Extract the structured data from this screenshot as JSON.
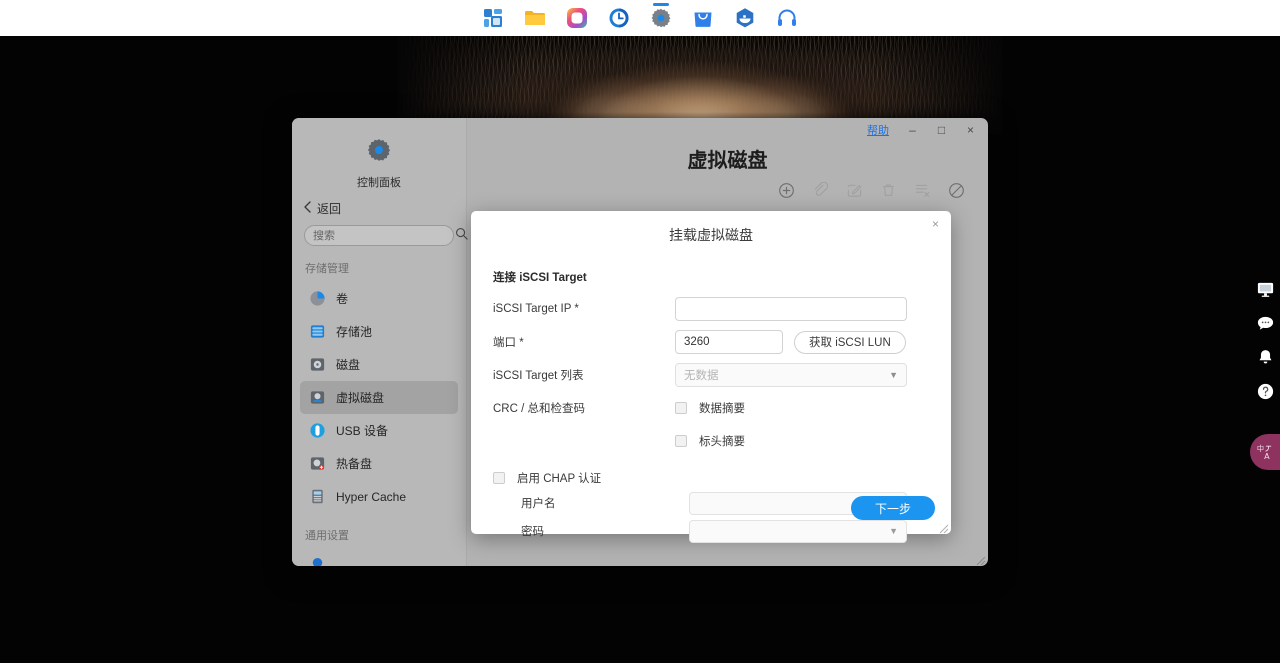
{
  "dock": {
    "items": [
      {
        "name": "dashboard-icon",
        "label": "Dashboard",
        "active": false
      },
      {
        "name": "file-manager-icon",
        "label": "File Manager",
        "active": false
      },
      {
        "name": "photos-icon",
        "label": "Photos",
        "active": false
      },
      {
        "name": "time-machine-icon",
        "label": "Time Machine",
        "active": false
      },
      {
        "name": "control-panel-icon",
        "label": "Control Panel",
        "active": true
      },
      {
        "name": "app-store-icon",
        "label": "App Center",
        "active": false
      },
      {
        "name": "docker-icon",
        "label": "Container Station",
        "active": false
      },
      {
        "name": "support-icon",
        "label": "Support",
        "active": false
      }
    ]
  },
  "window": {
    "help_label": "帮助",
    "minimize_label": "–",
    "maximize_label": "□",
    "close_label": "×"
  },
  "sidebar": {
    "brand_label": "控制面板",
    "back_label": "返回",
    "search_placeholder": "搜索",
    "search_value": "",
    "groups": [
      {
        "title": "存储管理",
        "items": [
          {
            "label": "卷",
            "icon": "volume-icon",
            "active": false
          },
          {
            "label": "存储池",
            "icon": "storage-pool-icon",
            "active": false
          },
          {
            "label": "磁盘",
            "icon": "disk-icon",
            "active": false
          },
          {
            "label": "虚拟磁盘",
            "icon": "virtual-disk-icon",
            "active": true
          },
          {
            "label": "USB 设备",
            "icon": "usb-device-icon",
            "active": false
          },
          {
            "label": "热备盘",
            "icon": "hot-spare-icon",
            "active": false
          },
          {
            "label": "Hyper Cache",
            "icon": "hyper-cache-icon",
            "active": false
          }
        ]
      },
      {
        "title": "通用设置",
        "items": []
      }
    ]
  },
  "main": {
    "page_title": "虚拟磁盘",
    "toolbar": [
      {
        "name": "add-icon",
        "label": "添加",
        "disabled": false
      },
      {
        "name": "link-icon",
        "label": "连接",
        "disabled": true
      },
      {
        "name": "edit-icon",
        "label": "编辑",
        "disabled": true
      },
      {
        "name": "delete-icon",
        "label": "删除",
        "disabled": true
      },
      {
        "name": "disconnect-icon",
        "label": "断开",
        "disabled": true
      },
      {
        "name": "block-icon",
        "label": "禁用",
        "disabled": false
      }
    ]
  },
  "modal": {
    "title": "挂载虚拟磁盘",
    "close_label": "×",
    "section_title": "连接 iSCSI Target",
    "fields": {
      "target_ip_label": "iSCSI Target IP *",
      "target_ip_value": "",
      "port_label": "端口 *",
      "port_value": "3260",
      "get_lun_button": "获取 iSCSI LUN",
      "target_list_label": "iSCSI Target 列表",
      "target_list_value": "无数据",
      "crc_label": "CRC / 总和检查码",
      "crc_options": [
        {
          "label": "数据摘要",
          "checked": false
        },
        {
          "label": "标头摘要",
          "checked": false
        }
      ],
      "chap_enable_label": "启用 CHAP 认证",
      "chap_enabled": false,
      "username_label": "用户名",
      "username_value": "",
      "password_label": "密码",
      "password_value": ""
    },
    "next_button": "下一步"
  },
  "right_rail": [
    {
      "name": "remote-display-icon",
      "label": "远程显示"
    },
    {
      "name": "chat-icon",
      "label": "聊天"
    },
    {
      "name": "notification-bell-icon",
      "label": "通知"
    },
    {
      "name": "help-circle-icon",
      "label": "帮助"
    }
  ],
  "translate_fab": {
    "name": "translate-icon",
    "label": "翻译"
  },
  "colors": {
    "accent": "#1b95f0",
    "link": "#1a73e8",
    "window_bg": "#b3b3b3",
    "sidebar_bg": "#b8b8b8",
    "sidebar_active": "#a3a3a3",
    "fab": "#8e3260"
  }
}
